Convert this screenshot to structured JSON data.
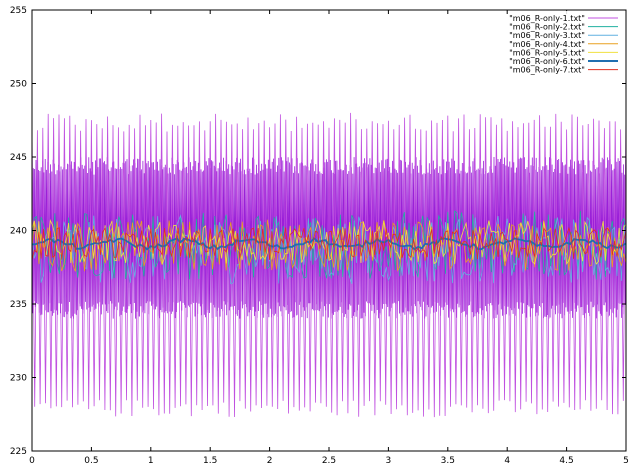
{
  "chart_data": {
    "type": "line",
    "title": "",
    "xlabel": "",
    "ylabel": "",
    "xlim": [
      0,
      5
    ],
    "ylim": [
      225,
      255
    ],
    "x_ticks": [
      0,
      0.5,
      1,
      1.5,
      2,
      2.5,
      3,
      3.5,
      4,
      4.5,
      5
    ],
    "x_tick_labels": [
      "0",
      "0.5",
      "1",
      "1.5",
      "2",
      "2.5",
      "3",
      "3.5",
      "4",
      "4.5",
      "5"
    ],
    "y_ticks": [
      225,
      230,
      235,
      240,
      245,
      250,
      255
    ],
    "y_tick_labels": [
      "225",
      "230",
      "235",
      "240",
      "245",
      "250",
      "255"
    ],
    "grid": false,
    "legend_position": "top-right",
    "series": [
      {
        "name": "\"m06_R-only-1.txt\"",
        "color": "#c050e0",
        "min": 227.3,
        "max": 248.0,
        "center": 239.0,
        "note_shape": "high-amplitude periodic spikes"
      },
      {
        "name": "\"m06_R-only-2.txt\"",
        "color": "#20b0a0",
        "min": 236.0,
        "max": 241.5,
        "center": 239.0
      },
      {
        "name": "\"m06_R-only-3.txt\"",
        "color": "#60b0e0",
        "min": 235.5,
        "max": 241.0,
        "center": 238.7
      },
      {
        "name": "\"m06_R-only-4.txt\"",
        "color": "#e8a020",
        "min": 237.3,
        "max": 241.5,
        "center": 239.0
      },
      {
        "name": "\"m06_R-only-5.txt\"",
        "color": "#f0e040",
        "min": 237.5,
        "max": 241.0,
        "center": 239.2
      },
      {
        "name": "\"m06_R-only-6.txt\"",
        "color": "#1f6fb0",
        "min": 238.6,
        "max": 239.6,
        "center": 239.1
      },
      {
        "name": "\"m06_R-only-7.txt\"",
        "color": "#e03020",
        "min": 238.0,
        "max": 240.6,
        "center": 239.1
      }
    ],
    "dense_band": {
      "color": "#9b20d8",
      "min": 234.0,
      "max": 245.0
    }
  }
}
